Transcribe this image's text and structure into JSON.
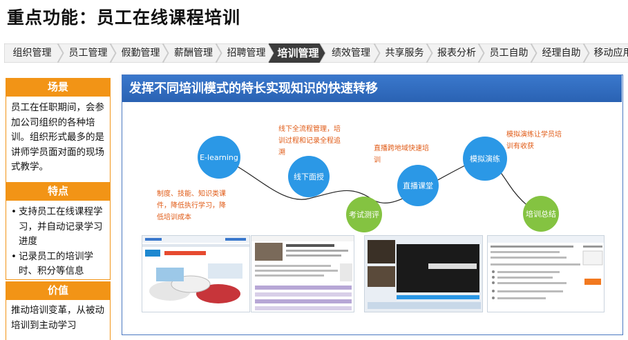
{
  "page_title": "重点功能：员工在线课程培训",
  "nav": {
    "items": [
      "组织管理",
      "员工管理",
      "假勤管理",
      "薪酬管理",
      "招聘管理",
      "培训管理",
      "绩效管理",
      "共享服务",
      "报表分析",
      "员工自助",
      "经理自助",
      "移动应用"
    ],
    "active": "培训管理"
  },
  "sidebar": {
    "scene": {
      "title": "场景",
      "text": "员工在任职期间，会参加公司组织的各种培训。组织形式最多的是讲师学员面对面的现场式教学。"
    },
    "features": {
      "title": "特点",
      "items": [
        "支持员工在线课程学习，并自动记录学习进度",
        "记录员工的培训学时、积分等信息"
      ]
    },
    "value": {
      "title": "价值",
      "text": "推动培训变革，从被动培训到主动学习"
    }
  },
  "main": {
    "heading": "发挥不同培训模式的特长实现知识的快速转移",
    "nodes": [
      "E-learning",
      "线下面授",
      "考试测评",
      "直播课堂",
      "模拟演练",
      "培训总结"
    ],
    "annotations": [
      "制度、技能、知识类课件，降低执行学习，降低培训成本",
      "线下全流程管理，培训过程和记录全程追溯",
      "直播跨地域快速培训",
      "模拟演练让学员培训有收获"
    ]
  },
  "colors": {
    "accent_orange": "#f29416",
    "node_blue": "#2b98e6",
    "node_green": "#84c341",
    "header_blue": "#2e6bbf",
    "annotation": "#e05a15",
    "nav_active": "#3c3c3c"
  }
}
